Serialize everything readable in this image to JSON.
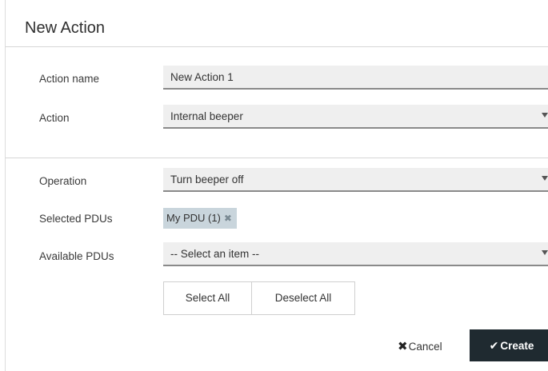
{
  "dialog": {
    "title": "New Action"
  },
  "form": {
    "action_name": {
      "label": "Action name",
      "value": "New Action 1"
    },
    "action": {
      "label": "Action",
      "value": "Internal beeper"
    },
    "operation": {
      "label": "Operation",
      "value": "Turn beeper off"
    },
    "selected_pdus": {
      "label": "Selected PDUs",
      "tags": [
        "My PDU (1)"
      ]
    },
    "available_pdus": {
      "label": "Available PDUs",
      "value": "-- Select an item --"
    }
  },
  "buttons": {
    "select_all": "Select All",
    "deselect_all": "Deselect All",
    "cancel": "Cancel",
    "create": "Create"
  },
  "icons": {
    "tag_remove": "close-icon",
    "dropdown": "chevron-down-icon",
    "cancel": "close-icon",
    "create": "checkmark-icon"
  },
  "colors": {
    "create_button_bg": "#1f2a30",
    "tag_bg": "#c9d5dc",
    "field_bg": "#efefef"
  }
}
